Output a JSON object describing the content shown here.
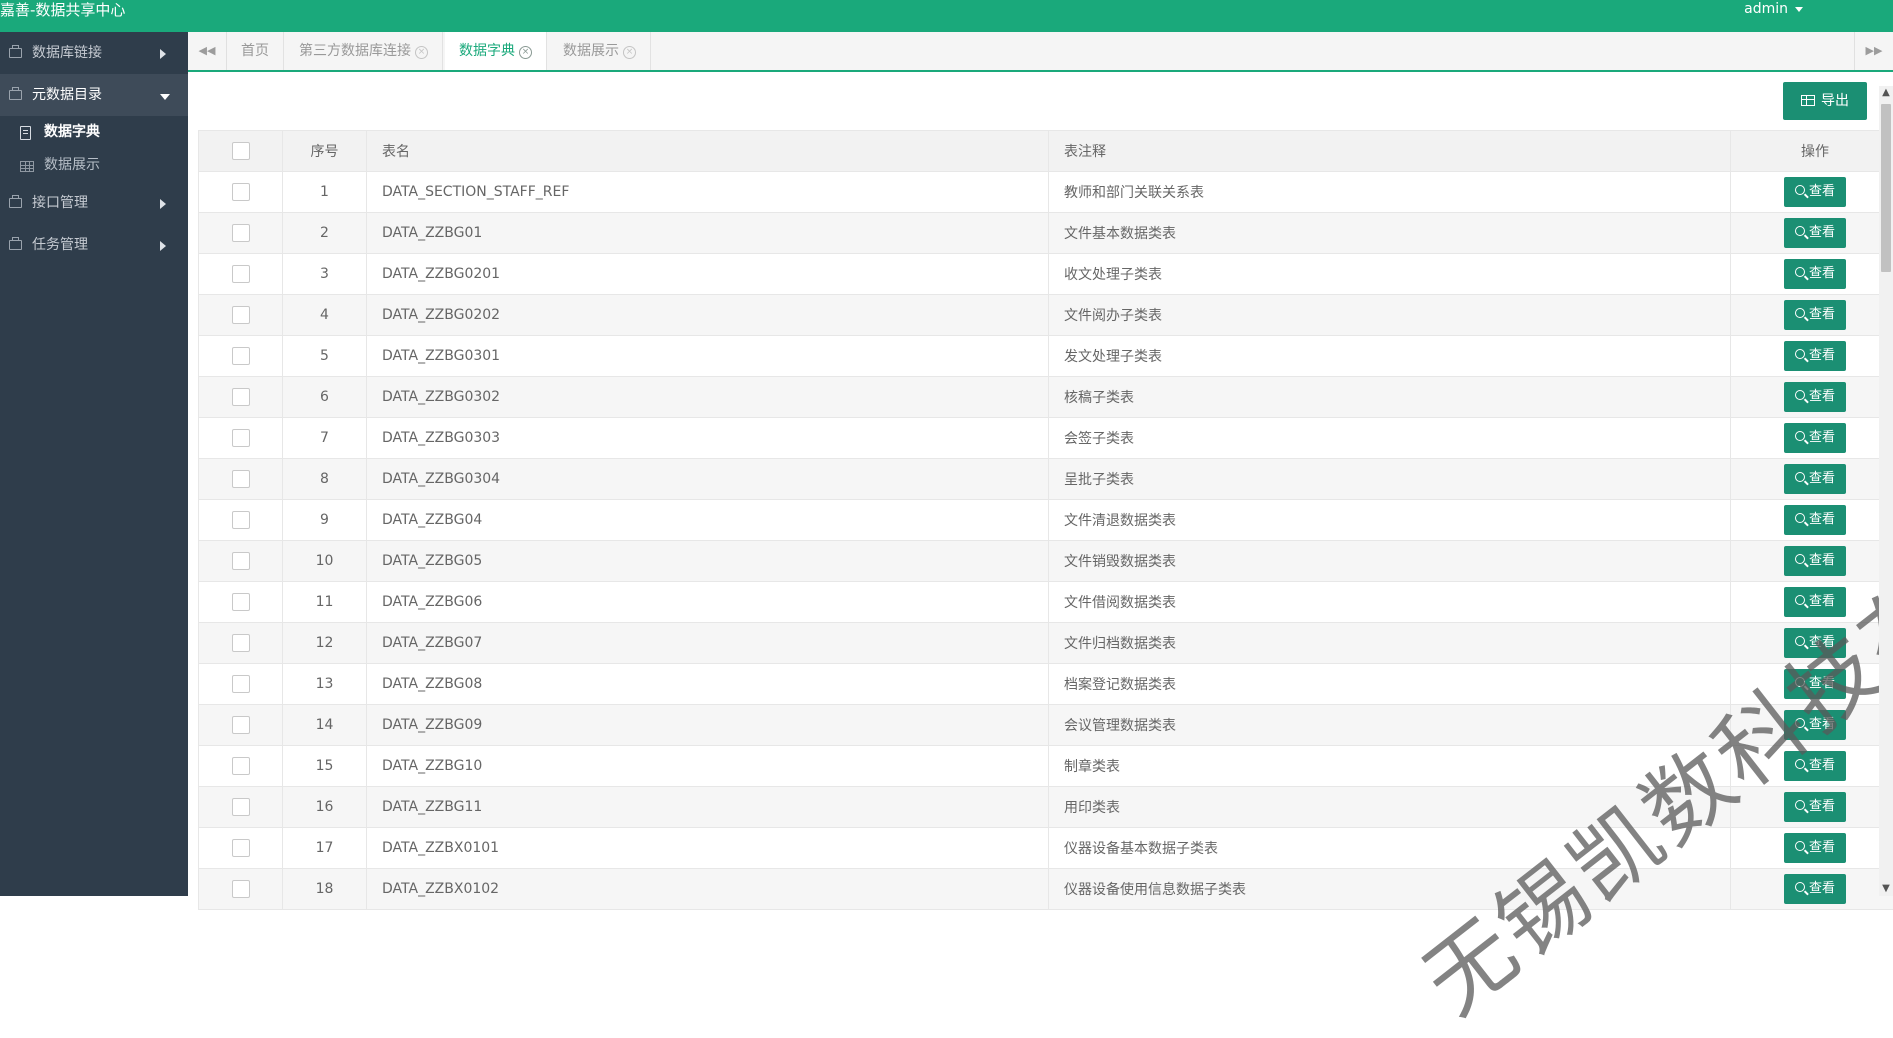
{
  "app": {
    "title": "嘉善-数据共享中心",
    "user": "admin"
  },
  "sidebar": {
    "items": [
      {
        "label": "数据库链接"
      },
      {
        "label": "元数据目录",
        "children": [
          {
            "label": "数据字典"
          },
          {
            "label": "数据展示"
          }
        ]
      },
      {
        "label": "接口管理"
      },
      {
        "label": "任务管理"
      }
    ]
  },
  "tabs": [
    {
      "label": "首页"
    },
    {
      "label": "第三方数据库连接"
    },
    {
      "label": "数据字典"
    },
    {
      "label": "数据展示"
    }
  ],
  "toolbar": {
    "export_label": "导出"
  },
  "table": {
    "headers": {
      "index": "序号",
      "name": "表名",
      "comment": "表注释",
      "op": "操作"
    },
    "view_label": "查看",
    "rows": [
      {
        "index": "1",
        "name": "DATA_SECTION_STAFF_REF",
        "comment": "教师和部门关联关系表"
      },
      {
        "index": "2",
        "name": "DATA_ZZBG01",
        "comment": "文件基本数据类表"
      },
      {
        "index": "3",
        "name": "DATA_ZZBG0201",
        "comment": "收文处理子类表"
      },
      {
        "index": "4",
        "name": "DATA_ZZBG0202",
        "comment": "文件阅办子类表"
      },
      {
        "index": "5",
        "name": "DATA_ZZBG0301",
        "comment": "发文处理子类表"
      },
      {
        "index": "6",
        "name": "DATA_ZZBG0302",
        "comment": "核稿子类表"
      },
      {
        "index": "7",
        "name": "DATA_ZZBG0303",
        "comment": "会签子类表"
      },
      {
        "index": "8",
        "name": "DATA_ZZBG0304",
        "comment": "呈批子类表"
      },
      {
        "index": "9",
        "name": "DATA_ZZBG04",
        "comment": "文件清退数据类表"
      },
      {
        "index": "10",
        "name": "DATA_ZZBG05",
        "comment": "文件销毁数据类表"
      },
      {
        "index": "11",
        "name": "DATA_ZZBG06",
        "comment": "文件借阅数据类表"
      },
      {
        "index": "12",
        "name": "DATA_ZZBG07",
        "comment": "文件归档数据类表"
      },
      {
        "index": "13",
        "name": "DATA_ZZBG08",
        "comment": "档案登记数据类表"
      },
      {
        "index": "14",
        "name": "DATA_ZZBG09",
        "comment": "会议管理数据类表"
      },
      {
        "index": "15",
        "name": "DATA_ZZBG10",
        "comment": "制章类表"
      },
      {
        "index": "16",
        "name": "DATA_ZZBG11",
        "comment": "用印类表"
      },
      {
        "index": "17",
        "name": "DATA_ZZBX0101",
        "comment": "仪器设备基本数据子类表"
      },
      {
        "index": "18",
        "name": "DATA_ZZBX0102",
        "comment": "仪器设备使用信息数据子类表"
      }
    ]
  },
  "watermark": {
    "text": "无锡凯数科技有限公司"
  },
  "colors": {
    "brand": "#1aa97b",
    "button": "#1b8f73",
    "sidebar": "#2f3d4b"
  }
}
